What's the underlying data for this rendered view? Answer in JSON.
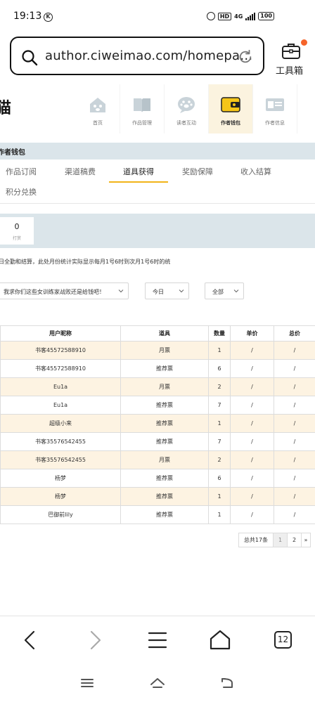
{
  "status_bar": {
    "time": "19:13",
    "k_badge": "K",
    "hd": "HD",
    "network": "4G",
    "battery": "100"
  },
  "browser": {
    "url": "author.ciweimao.com/homepa…",
    "toolbox_label": "工具箱"
  },
  "site": {
    "logo_fragment": "猫",
    "nav": [
      {
        "label": "首页",
        "icon": "home-icon"
      },
      {
        "label": "作品管理",
        "icon": "book-icon"
      },
      {
        "label": "读者互动",
        "icon": "paw-chat-icon"
      },
      {
        "label": "作者钱包",
        "icon": "wallet-icon"
      },
      {
        "label": "作者信息",
        "icon": "id-card-icon"
      }
    ],
    "section_title": "作者钱包"
  },
  "tabs": [
    "作品订阅",
    "渠道稿费",
    "道具获得",
    "奖励保障",
    "收入结算",
    "积分兑换"
  ],
  "active_tab": "道具获得",
  "stats": {
    "value": "0",
    "label": "打赏"
  },
  "notice": "日全勤和结算，此处月份统计实际显示每月1号6时到次月1号6时的统",
  "filters": {
    "book": "我求你们这些女训练家战败还是给钱吧！",
    "period": "今日",
    "type": "全部"
  },
  "table": {
    "headers": [
      "用户昵称",
      "道具",
      "数量",
      "单价",
      "总价"
    ],
    "rows": [
      [
        "书客45572588910",
        "月票",
        "1",
        "/",
        "/"
      ],
      [
        "书客45572588910",
        "推荐票",
        "6",
        "/",
        "/"
      ],
      [
        "Eu1a",
        "月票",
        "2",
        "/",
        "/"
      ],
      [
        "Eu1a",
        "推荐票",
        "7",
        "/",
        "/"
      ],
      [
        "超级小来",
        "推荐票",
        "1",
        "/",
        "/"
      ],
      [
        "书客35576542455",
        "推荐票",
        "7",
        "/",
        "/"
      ],
      [
        "书客35576542455",
        "月票",
        "2",
        "/",
        "/"
      ],
      [
        "杨梦",
        "推荐票",
        "6",
        "/",
        "/"
      ],
      [
        "杨梦",
        "推荐票",
        "1",
        "/",
        "/"
      ],
      [
        "巴御前lily",
        "推荐票",
        "1",
        "/",
        "/"
      ]
    ]
  },
  "pagination": {
    "total": "总共17条",
    "pages": [
      "1",
      "2"
    ],
    "current": "1",
    "next": "»"
  },
  "bottom_bar": {
    "tab_count": "12"
  },
  "colors": {
    "accent": "#f2b418",
    "active_tile": "#fbf3df",
    "section_band": "#dbe5ea",
    "row_highlight": "#fdf3e2",
    "toolbox_dot": "#f5642a"
  }
}
